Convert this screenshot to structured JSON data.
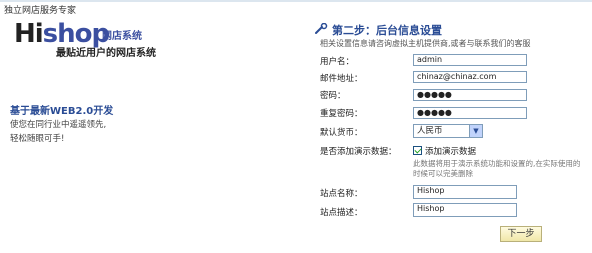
{
  "header": {
    "tagline": "独立网店服务专家"
  },
  "brand": {
    "logo_hi": "Hi",
    "logo_shop": "shop",
    "logo_sub": "网店系统",
    "slogan": "最贴近用户的网店系统"
  },
  "left_panel": {
    "title": "基于最新WEB2.0开发",
    "desc": "使您在同行业中遥遥领先,轻松随眼可手!"
  },
  "step": {
    "icon": "wrench-icon",
    "title": "第二步：后台信息设置",
    "hint": "相关设置信息请咨询虚拟主机提供商,或者与联系我们的客服"
  },
  "form": {
    "username": {
      "label": "用户名：",
      "value": "admin"
    },
    "email": {
      "label": "邮件地址：",
      "value": "chinaz@chinaz.com"
    },
    "password": {
      "label": "密码：",
      "value": "●●●●●"
    },
    "confirm_password": {
      "label": "重复密码：",
      "value": "●●●●●"
    },
    "currency": {
      "label": "默认货币：",
      "selected": "人民币"
    },
    "demo": {
      "label": "是否添加演示数据：",
      "checkbox_label": "添加演示数据",
      "checked": true,
      "note": "此数据将用于演示系统功能和设置的,在实际使用的时候可以完美删除"
    },
    "store_name": {
      "label": "站点名称：",
      "value": "Hishop"
    },
    "store_desc": {
      "label": "站点描述：",
      "value": "Hishop"
    }
  },
  "actions": {
    "next_label": "下一步"
  },
  "colors": {
    "accent_blue": "#2a4c95",
    "input_border": "#7f9db9",
    "button_bg": "#f0e7a8"
  }
}
